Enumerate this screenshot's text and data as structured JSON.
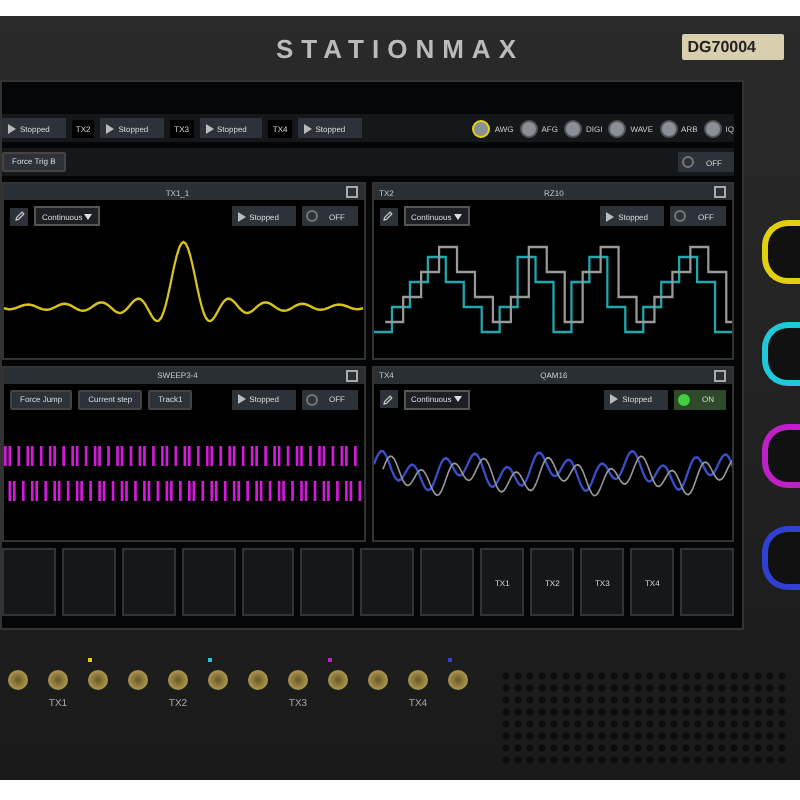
{
  "device": {
    "brand": "STATIONMAX",
    "model": "DG70004"
  },
  "toolbar": {
    "channels": [
      {
        "status": "Stopped"
      },
      {
        "label": "TX2",
        "status": "Stopped"
      },
      {
        "label": "TX3",
        "status": "Stopped"
      },
      {
        "label": "TX4",
        "status": "Stopped"
      }
    ],
    "modes": [
      {
        "label": "AWG",
        "selected": true
      },
      {
        "label": "AFG",
        "selected": false
      },
      {
        "label": "DIGI",
        "selected": false
      },
      {
        "label": "WAVE",
        "selected": false
      },
      {
        "label": "ARB",
        "selected": false
      },
      {
        "label": "IQ",
        "selected": false
      }
    ]
  },
  "trigger_bar": {
    "button": "Force Trig B",
    "power": {
      "label": "OFF",
      "on": false
    }
  },
  "panels": [
    {
      "title": "TX1_1",
      "mode": "Continuous",
      "status": "Stopped",
      "power": {
        "label": "OFF",
        "on": false
      },
      "kind": "sinc",
      "color": "#d8c21c"
    },
    {
      "channel": "TX2",
      "title": "RZ10",
      "mode": "Continuous",
      "status": "Stopped",
      "power": {
        "label": "OFF",
        "on": false
      },
      "kind": "steps",
      "color": "#1fa8b0"
    },
    {
      "title": "SWEEP3-4",
      "buttons": [
        "Force Jump",
        "Current step",
        "Track1"
      ],
      "status": "Stopped",
      "power": {
        "label": "OFF",
        "on": false
      },
      "kind": "digital",
      "color": "#d21ad8"
    },
    {
      "channel": "TX4",
      "title": "QAM16",
      "mode": "Continuous",
      "status": "Stopped",
      "power": {
        "label": "ON",
        "on": true
      },
      "kind": "noise",
      "color": "#3a4fc8"
    }
  ],
  "sync": [
    {
      "label": "TX1"
    },
    {
      "label": "TX2"
    },
    {
      "label": "TX3"
    },
    {
      "label": "TX4"
    }
  ],
  "ports": [
    {
      "label": "TX1",
      "color": "#e0d010"
    },
    {
      "label": "TX2",
      "color": "#20c8d8"
    },
    {
      "label": "TX3",
      "color": "#c020c8"
    },
    {
      "label": "TX4",
      "color": "#3040d0"
    }
  ]
}
